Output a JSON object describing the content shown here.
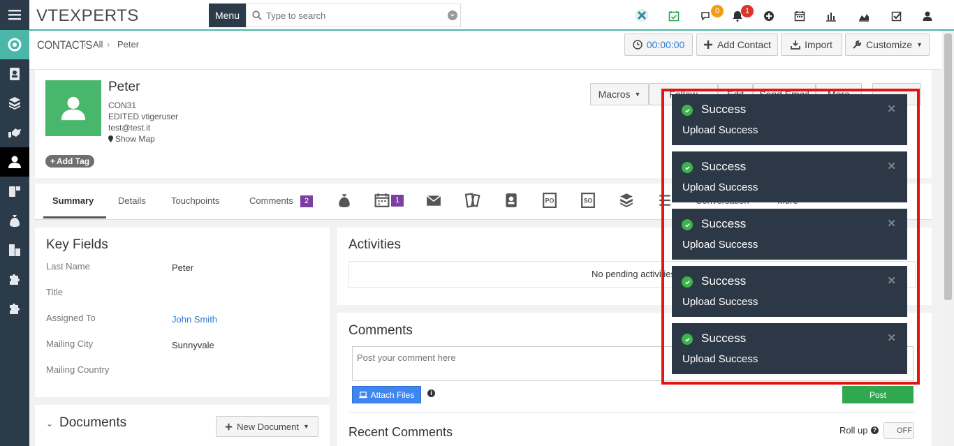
{
  "app": {
    "logo": "VTEXPERTS",
    "menu_label": "Menu",
    "search_placeholder": "Type to search",
    "chat_badge": "0",
    "bell_badge": "1"
  },
  "breadcrumb": {
    "module": "CONTACTS",
    "filter": "All",
    "record": "Peter"
  },
  "actions": {
    "timer": "00:00:00",
    "add_contact": "Add Contact",
    "import": "Import",
    "customize": "Customize"
  },
  "record": {
    "name": "Peter",
    "code": "CON31",
    "edited": "EDITED vtigeruser",
    "email": "test@test.it",
    "show_map": "Show Map",
    "add_tag": "Add Tag",
    "macros": "Macros",
    "hidden_buttons": [
      "Follow",
      "Edit",
      "Send Email",
      "More"
    ]
  },
  "tabs": {
    "summary": "Summary",
    "details": "Details",
    "touchpoints": "Touchpoints",
    "comments": "Comments",
    "comments_count": "2",
    "calendar_count": "1",
    "conversation": "Conversation",
    "more": "More"
  },
  "key_fields": {
    "title": "Key Fields",
    "rows": [
      {
        "label": "Last Name",
        "value": "Peter"
      },
      {
        "label": "Title",
        "value": ""
      },
      {
        "label": "Assigned To",
        "value": "John Smith"
      },
      {
        "label": "Mailing City",
        "value": "Sunnyvale"
      },
      {
        "label": "Mailing Country",
        "value": ""
      }
    ]
  },
  "documents": {
    "title": "Documents",
    "new_button": "New Document"
  },
  "activities": {
    "title": "Activities",
    "empty": "No pending activities"
  },
  "comments": {
    "title": "Comments",
    "placeholder": "Post your comment here",
    "attach": "Attach Files",
    "post": "Post",
    "recent": "Recent Comments",
    "roll_up": "Roll up",
    "toggle": "OFF"
  },
  "toasts": [
    {
      "title": "Success",
      "message": "Upload Success"
    },
    {
      "title": "Success",
      "message": "Upload Success"
    },
    {
      "title": "Success",
      "message": "Upload Success"
    },
    {
      "title": "Success",
      "message": "Upload Success"
    },
    {
      "title": "Success",
      "message": "Upload Success"
    }
  ],
  "colors": {
    "rail": "#2c3b49",
    "accent": "#4bb7a9",
    "avatar": "#48b76b",
    "toast": "#2d3846",
    "highlight_frame": "#e21313",
    "post": "#2fa84f",
    "attach": "#3f86f0"
  }
}
